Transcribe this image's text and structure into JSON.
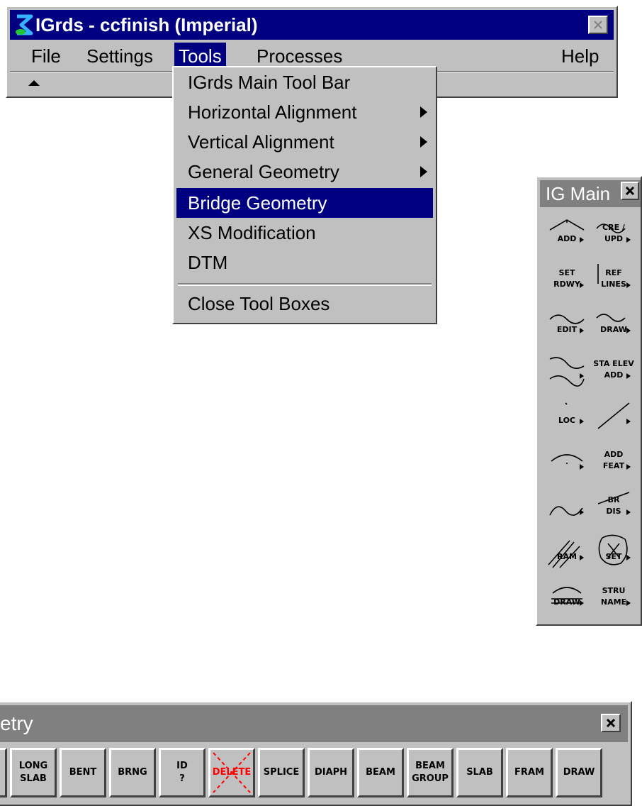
{
  "main_window": {
    "title": "IGrds - ccfinish (Imperial)",
    "menu": [
      "File",
      "Settings",
      "Tools",
      "Processes",
      "Help"
    ],
    "active_menu": "Tools",
    "accent": "#000080"
  },
  "tools_menu": {
    "items": [
      {
        "label": "IGrds Main Tool Bar",
        "submenu": false
      },
      {
        "label": "Horizontal Alignment",
        "submenu": true
      },
      {
        "label": "Vertical Alignment",
        "submenu": true
      },
      {
        "label": "General Geometry",
        "submenu": true
      },
      {
        "label": "Bridge Geometry",
        "submenu": false,
        "highlighted": true
      },
      {
        "label": "XS Modification",
        "submenu": false
      },
      {
        "label": "DTM",
        "submenu": false
      }
    ],
    "footer_item": "Close Tool Boxes"
  },
  "ig_main": {
    "title": "IG Main",
    "tools": [
      {
        "top": "",
        "bottom": "ADD"
      },
      {
        "top": "CRE /",
        "bottom": "UPD"
      },
      {
        "top": "SET",
        "bottom": "RDWY"
      },
      {
        "top": "REF",
        "bottom": "LINES"
      },
      {
        "top": "",
        "bottom": "EDIT"
      },
      {
        "top": "",
        "bottom": "DRAW"
      },
      {
        "top": "",
        "bottom": ""
      },
      {
        "top": "STA ELEV",
        "bottom": "ADD"
      },
      {
        "top": "",
        "bottom": "LOC"
      },
      {
        "top": "",
        "bottom": ""
      },
      {
        "top": "",
        "bottom": ""
      },
      {
        "top": "ADD",
        "bottom": "FEAT"
      },
      {
        "top": "",
        "bottom": ""
      },
      {
        "top": "BR",
        "bottom": "DIS"
      },
      {
        "top": "",
        "bottom": "RAM"
      },
      {
        "top": "",
        "bottom": "SET"
      },
      {
        "top": "",
        "bottom": "DRAW"
      },
      {
        "top": "STRU",
        "bottom": "NAME"
      }
    ]
  },
  "bridge_toolbox": {
    "title": "etry",
    "buttons": [
      "LONG\nSLAB",
      "BENT",
      "BRNG",
      "ID\n?",
      "DELETE",
      "SPLICE",
      "DIAPH",
      "BEAM",
      "BEAM\nGROUP",
      "SLAB",
      "FRAM",
      "DRAW"
    ],
    "delete_color": "#ff0000"
  }
}
